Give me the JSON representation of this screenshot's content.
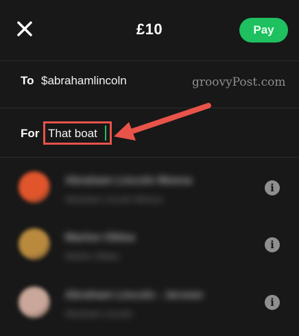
{
  "header": {
    "amount": "£10",
    "pay_label": "Pay"
  },
  "recipient": {
    "to_label": "To",
    "handle": "$abrahamlincoln"
  },
  "note": {
    "for_label": "For",
    "text": "That boat"
  },
  "watermark": "groovyPost.com",
  "contacts": [
    {
      "name": "Abraham Lincoln Meena",
      "detail": "Abraham Lincoln Meena ·",
      "avatar_color": "#e0552c"
    },
    {
      "name": "Marlon Oblea",
      "detail": "Marlon Oblea ·",
      "avatar_color": "#b98a3e"
    },
    {
      "name": "Abraham Lincoln - Jerseer",
      "detail": "Abraham Lincoln ·",
      "avatar_color": "#c9a79a"
    }
  ],
  "colors": {
    "accent": "#1ec05f",
    "highlight": "#e8534a",
    "background": "#181818"
  },
  "icons": {
    "close": "close-icon",
    "info": "info-icon"
  }
}
